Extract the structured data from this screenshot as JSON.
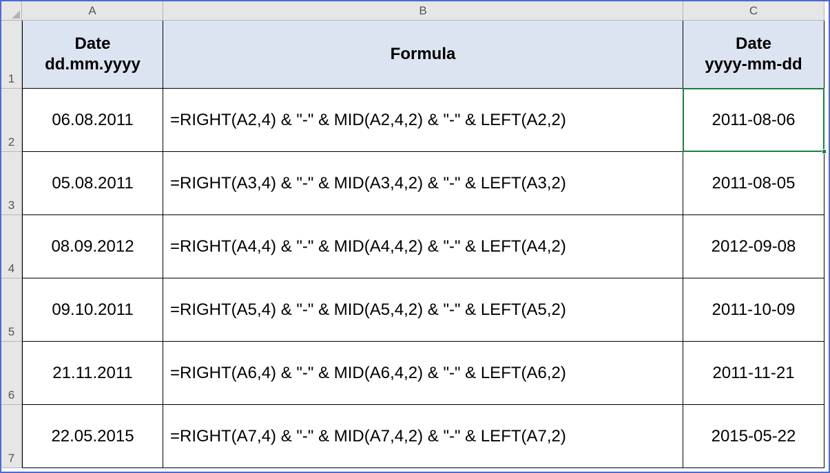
{
  "columns": {
    "labels": [
      "A",
      "B",
      "C"
    ],
    "widths": [
      205,
      755,
      205
    ]
  },
  "row_heights": {
    "header": 99,
    "data": 92
  },
  "headers": {
    "A": "Date\ndd.mm.yyyy",
    "B": "Formula",
    "C": "Date\nyyyy-mm-dd"
  },
  "rows": [
    {
      "n": 2,
      "A": "06.08.2011",
      "B": "=RIGHT(A2,4) & \"-\" & MID(A2,4,2) & \"-\" & LEFT(A2,2)",
      "C": "2011-08-06"
    },
    {
      "n": 3,
      "A": "05.08.2011",
      "B": "=RIGHT(A3,4) & \"-\" & MID(A3,4,2) & \"-\" & LEFT(A3,2)",
      "C": "2011-08-05"
    },
    {
      "n": 4,
      "A": "08.09.2012",
      "B": "=RIGHT(A4,4) & \"-\" & MID(A4,4,2) & \"-\" & LEFT(A4,2)",
      "C": "2012-09-08"
    },
    {
      "n": 5,
      "A": "09.10.2011",
      "B": "=RIGHT(A5,4) & \"-\" & MID(A5,4,2) & \"-\" & LEFT(A5,2)",
      "C": "2011-10-09"
    },
    {
      "n": 6,
      "A": "21.11.2011",
      "B": "=RIGHT(A6,4) & \"-\" & MID(A6,4,2) & \"-\" & LEFT(A6,2)",
      "C": "2011-11-21"
    },
    {
      "n": 7,
      "A": "22.05.2015",
      "B": "=RIGHT(A7,4) & \"-\" & MID(A7,4,2) & \"-\" & LEFT(A7,2)",
      "C": "2015-05-22"
    }
  ],
  "selection": {
    "cell": "C2"
  }
}
